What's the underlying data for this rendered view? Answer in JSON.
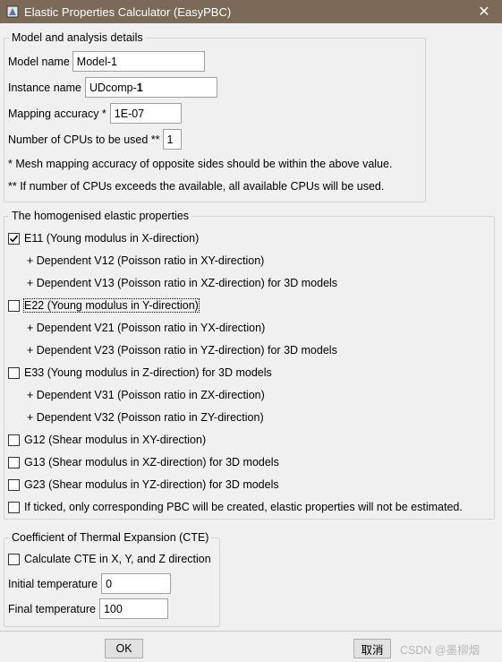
{
  "window": {
    "title": "Elastic Properties Calculator (EasyPBC)",
    "close_glyph": "✕"
  },
  "model_group": {
    "legend": "Model and analysis details",
    "model_name_label": "Model name",
    "model_name_value": "Model-1",
    "instance_name_label": "Instance name",
    "instance_prefix": "UDcomp-",
    "instance_suffix": "1",
    "mapping_label": "Mapping accuracy *",
    "mapping_value": "1E-07",
    "cpus_label": "Number of CPUs to be used **",
    "cpus_value": "1",
    "note1": "*  Mesh mapping accuracy of opposite sides should be within the above value.",
    "note2": "** If number of CPUs exceeds the available, all available CPUs will be used."
  },
  "props_group": {
    "legend": "The homogenised elastic properties",
    "items": [
      {
        "label": "E11 (Young modulus in X-direction)",
        "checked": true
      },
      {
        "label": "+ Dependent V12 (Poisson ratio in XY-direction)"
      },
      {
        "label": "+ Dependent V13 (Poisson ratio in XZ-direction) for 3D models"
      },
      {
        "label": "E22 (Young modulus in Y-direction)",
        "checked": false
      },
      {
        "label": "+ Dependent V21 (Poisson ratio in YX-direction)"
      },
      {
        "label": "+ Dependent V23 (Poisson ratio in YZ-direction) for 3D models"
      },
      {
        "label": "E33 (Young modulus in Z-direction) for 3D models",
        "checked": false
      },
      {
        "label": "+ Dependent V31 (Poisson ratio in ZX-direction)"
      },
      {
        "label": "+ Dependent V32 (Poisson ratio in ZY-direction)"
      },
      {
        "label": "G12 (Shear modulus in XY-direction)",
        "checked": false
      },
      {
        "label": "G13 (Shear modulus in XZ-direction) for 3D models",
        "checked": false
      },
      {
        "label": "G23 (Shear modulus in YZ-direction) for 3D models",
        "checked": false
      },
      {
        "label": "If ticked, only corresponding PBC will be created, elastic properties will not be estimated.",
        "checked": false
      }
    ]
  },
  "cte_group": {
    "legend": "Coefficient of Thermal Expansion (CTE)",
    "calc_label": "Calculate CTE in X, Y, and Z direction",
    "calc_checked": false,
    "initial_label": "Initial temperature",
    "initial_value": "0",
    "final_label": "Final temperature",
    "final_value": "100"
  },
  "buttons": {
    "ok": "OK",
    "cancel": "取消"
  },
  "watermark": "CSDN @墨柳烟",
  "colors": {
    "titlebar": "#7b6a58",
    "dialog_bg": "#f0f0f0"
  }
}
